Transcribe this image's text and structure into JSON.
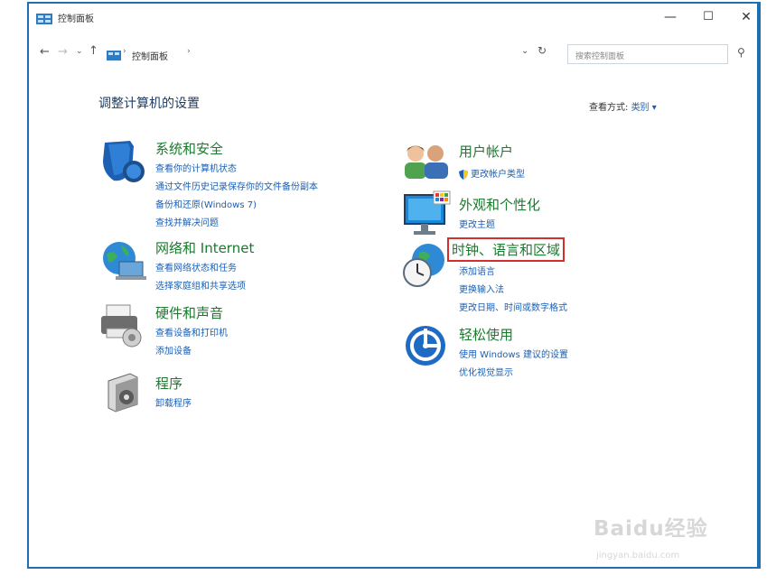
{
  "window": {
    "title": "控制面板",
    "controls": {
      "minimize": "—",
      "maximize": "☐",
      "close": "✕"
    }
  },
  "address_bar": {
    "breadcrumb": [
      "控制面板"
    ],
    "search_placeholder": "搜索控制面板"
  },
  "main": {
    "heading": "调整计算机的设置",
    "view_by_label": "查看方式:",
    "view_by_value": "类别 ▾"
  },
  "categories_left": [
    {
      "icon": "shield-icon",
      "title": "系统和安全",
      "links": [
        "查看你的计算机状态",
        "通过文件历史记录保存你的文件备份副本",
        "备份和还原(Windows 7)",
        "查找并解决问题"
      ]
    },
    {
      "icon": "network-globe-icon",
      "title": "网络和 Internet",
      "links": [
        "查看网络状态和任务",
        "选择家庭组和共享选项"
      ]
    },
    {
      "icon": "printer-icon",
      "title": "硬件和声音",
      "links": [
        "查看设备和打印机",
        "添加设备"
      ]
    },
    {
      "icon": "programs-icon",
      "title": "程序",
      "links": [
        "卸载程序"
      ]
    }
  ],
  "categories_right": [
    {
      "icon": "users-icon",
      "title": "用户帐户",
      "links": [
        "更改帐户类型"
      ]
    },
    {
      "icon": "monitor-icon",
      "title": "外观和个性化",
      "links": [
        "更改主题"
      ]
    },
    {
      "icon": "clock-globe-icon",
      "title": "时钟、语言和区域",
      "links": [
        "添加语言",
        "更换输入法",
        "更改日期、时间或数字格式"
      ]
    },
    {
      "icon": "ease-of-access-icon",
      "title": "轻松使用",
      "links": [
        "使用 Windows 建议的设置",
        "优化视觉显示"
      ]
    }
  ],
  "watermark": {
    "text": "Baidu经验",
    "sub": "jingyan.baidu.com"
  },
  "colors": {
    "accent": "#1f6fb2",
    "category_title": "#1a7a2d",
    "link": "#1a5fb4",
    "highlight": "#d32f2f"
  }
}
